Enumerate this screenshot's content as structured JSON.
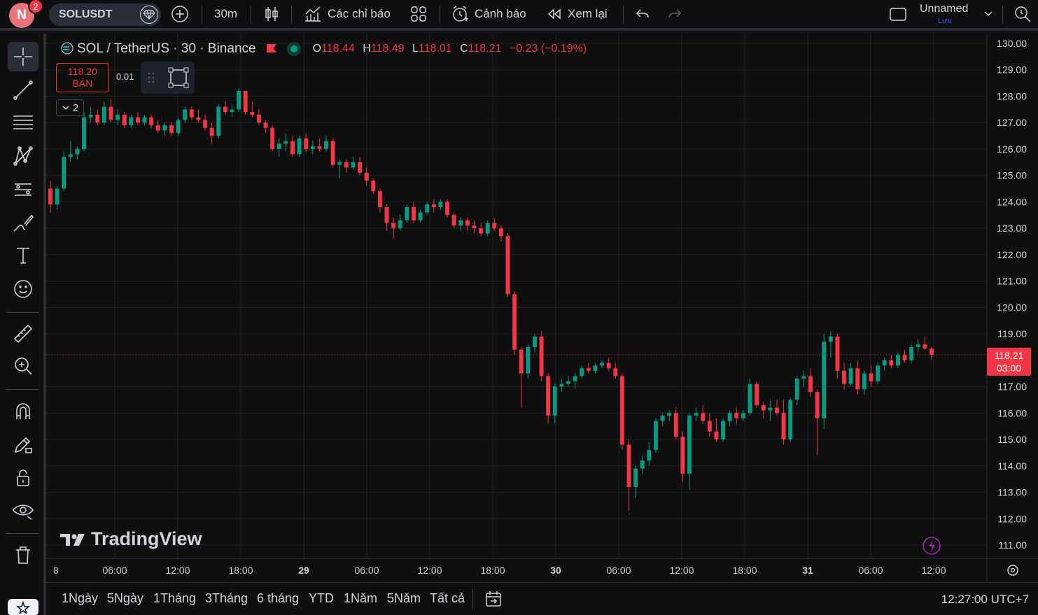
{
  "topbar": {
    "avatar_letter": "N",
    "notifications": "2",
    "symbol": "SOLUSDT",
    "interval": "30m",
    "indicators_label": "Các chỉ báo",
    "alerts_label": "Cảnh báo",
    "replay_label": "Xem lại",
    "layout_name": "Unnamed",
    "layout_save": "Lưu"
  },
  "legend": {
    "title": "SOL / TetherUS · 30 · Binance",
    "o_label": "O",
    "o": "118.44",
    "h_label": "H",
    "h": "118.49",
    "l_label": "L",
    "l": "118.01",
    "c_label": "C",
    "c": "118.21",
    "change": "−0.23 (−0.19%)"
  },
  "trade": {
    "sell_price": "118.20",
    "sell_label": "BÁN",
    "spread": "0.01",
    "collapse_count": "2"
  },
  "watermark": "TradingView",
  "price_label": {
    "price": "118.21",
    "countdown": "03:00"
  },
  "bottombar": {
    "ranges": [
      "1Ngày",
      "5Ngày",
      "1Tháng",
      "3Tháng",
      "6 tháng",
      "YTD",
      "1Năm",
      "5Năm",
      "Tất cả"
    ],
    "clock": "12:27:00 UTC+7"
  },
  "colors": {
    "up": "#089981",
    "down": "#f23645",
    "background": "#0f0f0f",
    "grid": "#1e2026"
  },
  "chart_data": {
    "type": "candlestick",
    "ylim": [
      111,
      130
    ],
    "yticks": [
      130,
      129,
      128,
      127,
      126,
      125,
      124,
      123,
      122,
      121,
      120,
      119,
      117,
      116,
      115,
      114,
      113,
      112,
      111
    ],
    "xtick_labels": [
      "8",
      "06:00",
      "12:00",
      "18:00",
      "29",
      "06:00",
      "12:00",
      "18:00",
      "30",
      "06:00",
      "12:00",
      "18:00",
      "31",
      "06:00",
      "12:00"
    ],
    "xtick_bold": [
      false,
      false,
      false,
      false,
      true,
      false,
      false,
      false,
      true,
      false,
      false,
      false,
      true,
      false,
      false
    ],
    "last_price": 118.21,
    "candles": [
      [
        124.5,
        124.8,
        123.6,
        123.9
      ],
      [
        123.9,
        124.6,
        123.7,
        124.5
      ],
      [
        124.5,
        125.9,
        124.4,
        125.7
      ],
      [
        125.7,
        126.3,
        125.5,
        125.8
      ],
      [
        125.8,
        126.1,
        125.6,
        126.0
      ],
      [
        126.0,
        127.4,
        125.9,
        127.2
      ],
      [
        127.2,
        127.6,
        127.0,
        127.3
      ],
      [
        127.3,
        127.5,
        126.9,
        127.0
      ],
      [
        127.0,
        127.8,
        126.9,
        127.6
      ],
      [
        127.6,
        127.9,
        127.0,
        127.1
      ],
      [
        127.1,
        127.5,
        126.9,
        127.3
      ],
      [
        127.3,
        127.4,
        126.8,
        126.9
      ],
      [
        126.9,
        127.3,
        126.8,
        127.2
      ],
      [
        127.2,
        127.4,
        126.9,
        127.0
      ],
      [
        127.0,
        127.3,
        126.9,
        127.2
      ],
      [
        127.2,
        127.3,
        126.8,
        126.9
      ],
      [
        126.9,
        127.1,
        126.6,
        126.7
      ],
      [
        126.7,
        127.0,
        126.5,
        126.9
      ],
      [
        126.9,
        127.0,
        126.5,
        126.6
      ],
      [
        126.6,
        127.2,
        126.5,
        127.1
      ],
      [
        127.1,
        127.6,
        127.0,
        127.5
      ],
      [
        127.5,
        127.6,
        127.1,
        127.2
      ],
      [
        127.2,
        127.5,
        127.0,
        127.1
      ],
      [
        127.1,
        127.3,
        126.7,
        126.8
      ],
      [
        126.8,
        127.0,
        126.2,
        126.5
      ],
      [
        126.5,
        127.7,
        126.4,
        127.6
      ],
      [
        127.6,
        127.8,
        127.3,
        127.4
      ],
      [
        127.4,
        127.7,
        127.2,
        127.5
      ],
      [
        127.5,
        128.3,
        127.4,
        128.2
      ],
      [
        128.2,
        128.2,
        127.3,
        127.4
      ],
      [
        127.4,
        127.8,
        127.2,
        127.3
      ],
      [
        127.3,
        127.5,
        126.9,
        127.0
      ],
      [
        127.0,
        127.1,
        126.6,
        126.8
      ],
      [
        126.8,
        126.9,
        125.9,
        126.0
      ],
      [
        126.0,
        126.4,
        125.7,
        126.2
      ],
      [
        126.2,
        126.6,
        125.9,
        126.3
      ],
      [
        126.3,
        126.5,
        125.7,
        125.8
      ],
      [
        125.8,
        126.5,
        125.7,
        126.4
      ],
      [
        126.4,
        126.6,
        125.9,
        126.0
      ],
      [
        126.0,
        126.3,
        125.8,
        126.1
      ],
      [
        126.1,
        126.4,
        125.9,
        126.0
      ],
      [
        126.0,
        126.5,
        125.9,
        126.3
      ],
      [
        126.3,
        126.4,
        125.3,
        125.4
      ],
      [
        125.4,
        125.6,
        124.9,
        125.5
      ],
      [
        125.5,
        125.6,
        125.1,
        125.3
      ],
      [
        125.3,
        125.7,
        125.2,
        125.5
      ],
      [
        125.5,
        125.7,
        125.0,
        125.1
      ],
      [
        125.1,
        125.3,
        124.6,
        124.8
      ],
      [
        124.8,
        124.9,
        124.3,
        124.4
      ],
      [
        124.4,
        124.5,
        123.6,
        123.8
      ],
      [
        123.8,
        123.9,
        122.9,
        123.2
      ],
      [
        123.2,
        123.4,
        122.6,
        123.0
      ],
      [
        123.0,
        123.5,
        122.9,
        123.3
      ],
      [
        123.3,
        123.9,
        123.2,
        123.8
      ],
      [
        123.8,
        124.0,
        123.2,
        123.3
      ],
      [
        123.3,
        123.7,
        123.2,
        123.6
      ],
      [
        123.6,
        124.0,
        123.5,
        123.9
      ],
      [
        123.9,
        124.1,
        123.6,
        123.8
      ],
      [
        123.8,
        124.1,
        123.7,
        124.0
      ],
      [
        124.0,
        124.1,
        123.4,
        123.5
      ],
      [
        123.5,
        123.6,
        123.0,
        123.1
      ],
      [
        123.1,
        123.4,
        122.9,
        123.3
      ],
      [
        123.3,
        123.4,
        122.9,
        123.1
      ],
      [
        123.1,
        123.3,
        122.8,
        123.0
      ],
      [
        123.0,
        123.2,
        122.7,
        122.8
      ],
      [
        122.8,
        123.3,
        122.7,
        123.2
      ],
      [
        123.2,
        123.4,
        122.9,
        123.0
      ],
      [
        123.0,
        123.1,
        122.5,
        122.7
      ],
      [
        122.7,
        122.8,
        120.4,
        120.5
      ],
      [
        120.5,
        120.6,
        118.2,
        118.4
      ],
      [
        118.4,
        118.5,
        116.2,
        117.5
      ],
      [
        117.5,
        118.6,
        117.3,
        118.5
      ],
      [
        118.5,
        119.0,
        118.3,
        118.9
      ],
      [
        118.9,
        119.1,
        117.2,
        117.4
      ],
      [
        117.4,
        117.5,
        115.6,
        115.9
      ],
      [
        115.9,
        117.1,
        115.6,
        117.0
      ],
      [
        117.0,
        117.3,
        116.8,
        117.1
      ],
      [
        117.1,
        117.4,
        117.0,
        117.2
      ],
      [
        117.2,
        117.5,
        116.9,
        117.4
      ],
      [
        117.4,
        117.8,
        117.3,
        117.7
      ],
      [
        117.7,
        117.9,
        117.5,
        117.6
      ],
      [
        117.6,
        117.9,
        117.5,
        117.8
      ],
      [
        117.8,
        118.0,
        117.7,
        117.9
      ],
      [
        117.9,
        118.1,
        117.6,
        117.7
      ],
      [
        117.7,
        117.9,
        117.3,
        117.4
      ],
      [
        117.4,
        117.5,
        114.6,
        114.8
      ],
      [
        114.8,
        115.0,
        112.3,
        113.2
      ],
      [
        113.2,
        114.0,
        112.8,
        113.9
      ],
      [
        113.9,
        114.4,
        113.7,
        114.2
      ],
      [
        114.2,
        114.9,
        114.0,
        114.6
      ],
      [
        114.6,
        115.8,
        114.5,
        115.7
      ],
      [
        115.7,
        116.0,
        115.5,
        115.9
      ],
      [
        115.9,
        116.1,
        115.7,
        116.0
      ],
      [
        116.0,
        116.2,
        115.0,
        115.1
      ],
      [
        115.1,
        115.3,
        113.4,
        113.7
      ],
      [
        113.7,
        116.0,
        113.1,
        115.9
      ],
      [
        115.9,
        116.2,
        115.7,
        116.0
      ],
      [
        116.0,
        116.3,
        115.6,
        115.7
      ],
      [
        115.7,
        116.0,
        115.1,
        115.3
      ],
      [
        115.3,
        115.8,
        114.9,
        115.0
      ],
      [
        115.0,
        115.8,
        114.9,
        115.7
      ],
      [
        115.7,
        116.1,
        115.5,
        116.0
      ],
      [
        116.0,
        116.2,
        115.6,
        115.8
      ],
      [
        115.8,
        116.1,
        115.7,
        116.0
      ],
      [
        116.0,
        117.3,
        115.9,
        117.1
      ],
      [
        117.1,
        117.2,
        116.2,
        116.3
      ],
      [
        116.3,
        116.4,
        115.8,
        116.1
      ],
      [
        116.1,
        116.5,
        115.7,
        116.2
      ],
      [
        116.2,
        116.5,
        115.9,
        116.0
      ],
      [
        116.0,
        116.5,
        114.8,
        115.0
      ],
      [
        115.0,
        116.6,
        114.9,
        116.5
      ],
      [
        116.5,
        117.4,
        116.3,
        117.3
      ],
      [
        117.3,
        117.6,
        117.0,
        117.4
      ],
      [
        117.4,
        117.7,
        116.6,
        116.8
      ],
      [
        116.8,
        116.9,
        114.4,
        115.8
      ],
      [
        115.8,
        119.0,
        115.4,
        118.7
      ],
      [
        118.7,
        119.1,
        118.1,
        118.9
      ],
      [
        118.9,
        119.0,
        117.3,
        117.6
      ],
      [
        117.6,
        117.9,
        116.9,
        117.1
      ],
      [
        117.1,
        117.9,
        117.0,
        117.7
      ],
      [
        117.7,
        118.0,
        116.7,
        116.9
      ],
      [
        116.9,
        117.6,
        116.7,
        117.5
      ],
      [
        117.5,
        117.8,
        117.0,
        117.2
      ],
      [
        117.2,
        117.9,
        117.1,
        117.8
      ],
      [
        117.8,
        118.1,
        117.6,
        118.0
      ],
      [
        118.0,
        118.2,
        117.7,
        117.8
      ],
      [
        117.8,
        118.3,
        117.7,
        118.2
      ],
      [
        118.2,
        118.4,
        117.9,
        118.0
      ],
      [
        118.0,
        118.6,
        117.9,
        118.5
      ],
      [
        118.5,
        118.8,
        118.3,
        118.6
      ],
      [
        118.6,
        118.9,
        118.4,
        118.44
      ],
      [
        118.44,
        118.49,
        118.01,
        118.21
      ]
    ]
  }
}
